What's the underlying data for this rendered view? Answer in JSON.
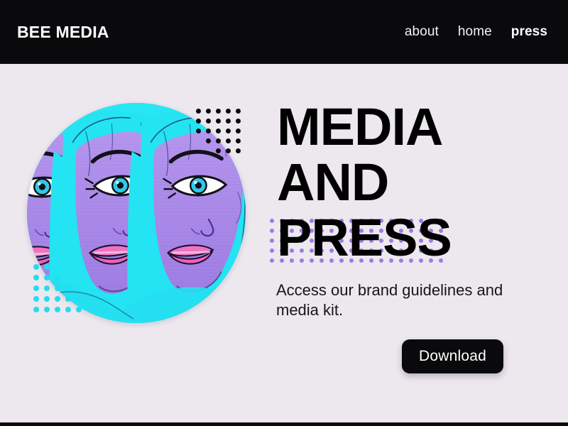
{
  "header": {
    "logo": "BEE MEDIA",
    "nav": [
      {
        "label": "about",
        "active": false
      },
      {
        "label": "home",
        "active": false
      },
      {
        "label": "press",
        "active": true
      }
    ]
  },
  "hero": {
    "headline_lines": [
      "MEDIA",
      "AND",
      "PRESS"
    ],
    "subtitle": "Access our brand guidelines and media kit.",
    "cta_label": "Download",
    "artwork_alt": "pop-art illustration of repeated female faces with cyan hair, purple skin and pink lips"
  },
  "decor": {
    "black_dots_label": "black-dot-grid",
    "cyan_dots_label": "cyan-dot-grid",
    "purple_dots_label": "purple-dot-grid"
  },
  "colors": {
    "header_bg": "#0a0a0c",
    "page_bg": "#ece8ee",
    "text_dark": "#000000",
    "text_light": "#ffffff",
    "accent_cyan": "#25dcee",
    "accent_purple": "#9d7ae8",
    "skin_purple": "#a789e6",
    "lips_pink": "#f06fc0",
    "button_bg": "#0a0a0c"
  }
}
